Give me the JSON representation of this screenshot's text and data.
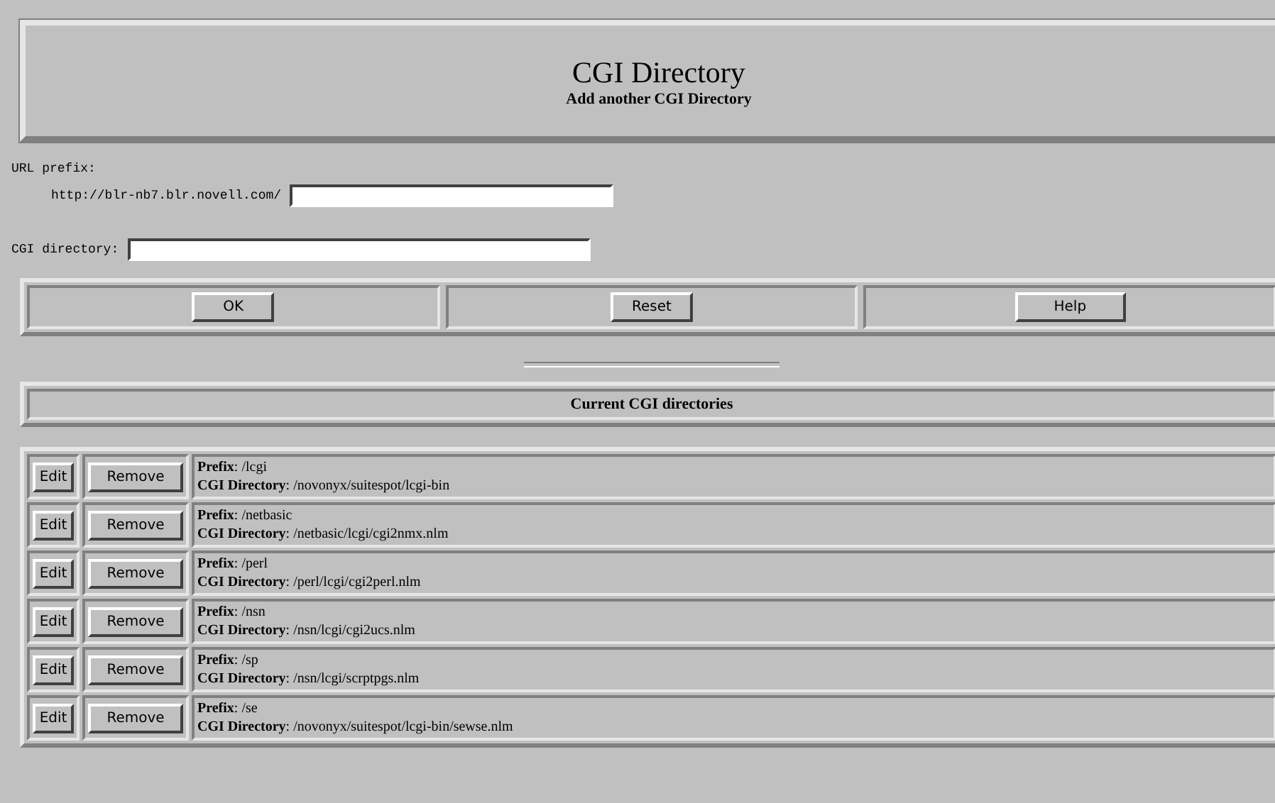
{
  "header": {
    "title": "CGI Directory",
    "subtitle": "Add another CGI Directory"
  },
  "form": {
    "url_prefix_label": "URL prefix:",
    "url_base": "http://blr-nb7.blr.novell.com/",
    "cgi_directory_label": "CGI directory:"
  },
  "buttons": [
    "OK",
    "Reset",
    "Help"
  ],
  "list_heading": "Current CGI directories",
  "entries": [
    {
      "edit": "Edit",
      "remove": "Remove",
      "prefix": "**Prefix**: /lcgi",
      "directory": "**CGI Directory**: /novonyx/suitespot/lcgi-bin"
    },
    {
      "edit": "Edit",
      "remove": "Remove",
      "prefix": "**Prefix**: /netbasic",
      "directory": "**CGI Directory**: /netbasic/lcgi/cgi2nmx.nlm"
    },
    {
      "edit": "Edit",
      "remove": "Remove",
      "prefix": "**Prefix**: /perl",
      "directory": "**CGI Directory**: /perl/lcgi/cgi2perl.nlm"
    },
    {
      "edit": "Edit",
      "remove": "Remove",
      "prefix": "**Prefix**: /nsn",
      "directory": "**CGI Directory**: /nsn/lcgi/cgi2ucs.nlm"
    },
    {
      "edit": "Edit",
      "remove": "Remove",
      "prefix": "**Prefix**: /sp",
      "directory": "**CGI Directory**: /nsn/lcgi/scrptpgs.nlm"
    },
    {
      "edit": "Edit",
      "remove": "Remove",
      "prefix": "**Prefix**: /se",
      "directory": "**CGI Directory**: /novonyx/suitespot/lcgi-bin/sewse.nlm"
    }
  ]
}
